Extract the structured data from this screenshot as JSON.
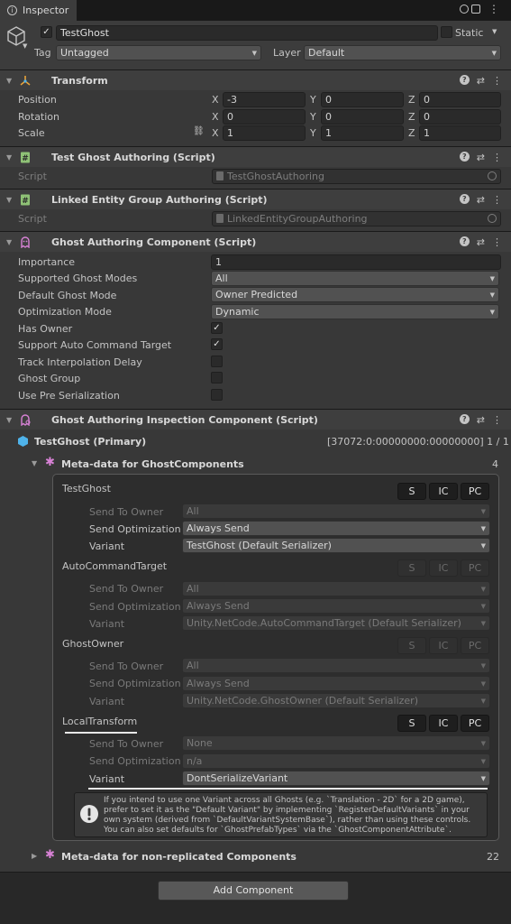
{
  "tab": {
    "label": "Inspector"
  },
  "object": {
    "name": "TestGhost",
    "static_label": "Static",
    "tag_label": "Tag",
    "tag_value": "Untagged",
    "layer_label": "Layer",
    "layer_value": "Default"
  },
  "transform": {
    "title": "Transform",
    "rows": [
      {
        "label": "Position",
        "x": "-3",
        "y": "0",
        "z": "0"
      },
      {
        "label": "Rotation",
        "x": "0",
        "y": "0",
        "z": "0"
      },
      {
        "label": "Scale",
        "x": "1",
        "y": "1",
        "z": "1"
      }
    ],
    "axis_x": "X",
    "axis_y": "Y",
    "axis_z": "Z"
  },
  "test_ghost_authoring": {
    "title": "Test Ghost Authoring (Script)",
    "script_label": "Script",
    "script_value": "TestGhostAuthoring"
  },
  "linked_entity": {
    "title": "Linked Entity Group Authoring (Script)",
    "script_label": "Script",
    "script_value": "LinkedEntityGroupAuthoring"
  },
  "ghost_authoring": {
    "title": "Ghost Authoring Component (Script)",
    "importance_label": "Importance",
    "importance_value": "1",
    "supported_modes_label": "Supported Ghost Modes",
    "supported_modes_value": "All",
    "default_mode_label": "Default Ghost Mode",
    "default_mode_value": "Owner Predicted",
    "optimization_label": "Optimization Mode",
    "optimization_value": "Dynamic",
    "has_owner_label": "Has Owner",
    "has_owner": true,
    "auto_cmd_label": "Support Auto Command Target",
    "auto_cmd": true,
    "track_interp_label": "Track Interpolation Delay",
    "track_interp": false,
    "ghost_group_label": "Ghost Group",
    "ghost_group": false,
    "pre_serialization_label": "Use Pre Serialization",
    "pre_serialization": false
  },
  "inspection": {
    "title": "Ghost Authoring Inspection Component (Script)",
    "primary_label": "TestGhost (Primary)",
    "primary_id": "[37072:0:00000000:00000000] 1 / 1",
    "meta_label": "Meta-data for GhostComponents",
    "meta_count": "4",
    "nonrep_label": "Meta-data for non-replicated Components",
    "nonrep_count": "22",
    "btn_s": "S",
    "btn_ic": "IC",
    "btn_pc": "PC",
    "send_to_owner_label": "Send To Owner",
    "send_opt_label": "Send Optimization",
    "variant_label": "Variant",
    "components": [
      {
        "name": "TestGhost",
        "send_to_owner": "All",
        "send_opt": "Always Send",
        "variant": "TestGhost (Default Serializer)"
      },
      {
        "name": "AutoCommandTarget",
        "send_to_owner": "All",
        "send_opt": "Always Send",
        "variant": "Unity.NetCode.AutoCommandTarget (Default Serializer)"
      },
      {
        "name": "GhostOwner",
        "send_to_owner": "All",
        "send_opt": "Always Send",
        "variant": "Unity.NetCode.GhostOwner (Default Serializer)"
      },
      {
        "name": "LocalTransform",
        "send_to_owner": "None",
        "send_opt": "n/a",
        "variant": "DontSerializeVariant"
      }
    ],
    "help_text": "If you intend to use one Variant across all Ghosts (e.g. `Translation - 2D` for a 2D game), prefer to set it as the \"Default Variant\" by implementing `RegisterDefaultVariants` in your own system (derived from `DefaultVariantSystemBase`), rather than using these controls. You can also set defaults for `GhostPrefabTypes` via the `GhostComponentAttribute`."
  },
  "add_component": "Add Component",
  "colors": {
    "accent_blue": "#4fb3ea",
    "script_green": "#8fc276",
    "ghost_purple": "#d882d6",
    "transform_axes": "#e8a33a"
  }
}
